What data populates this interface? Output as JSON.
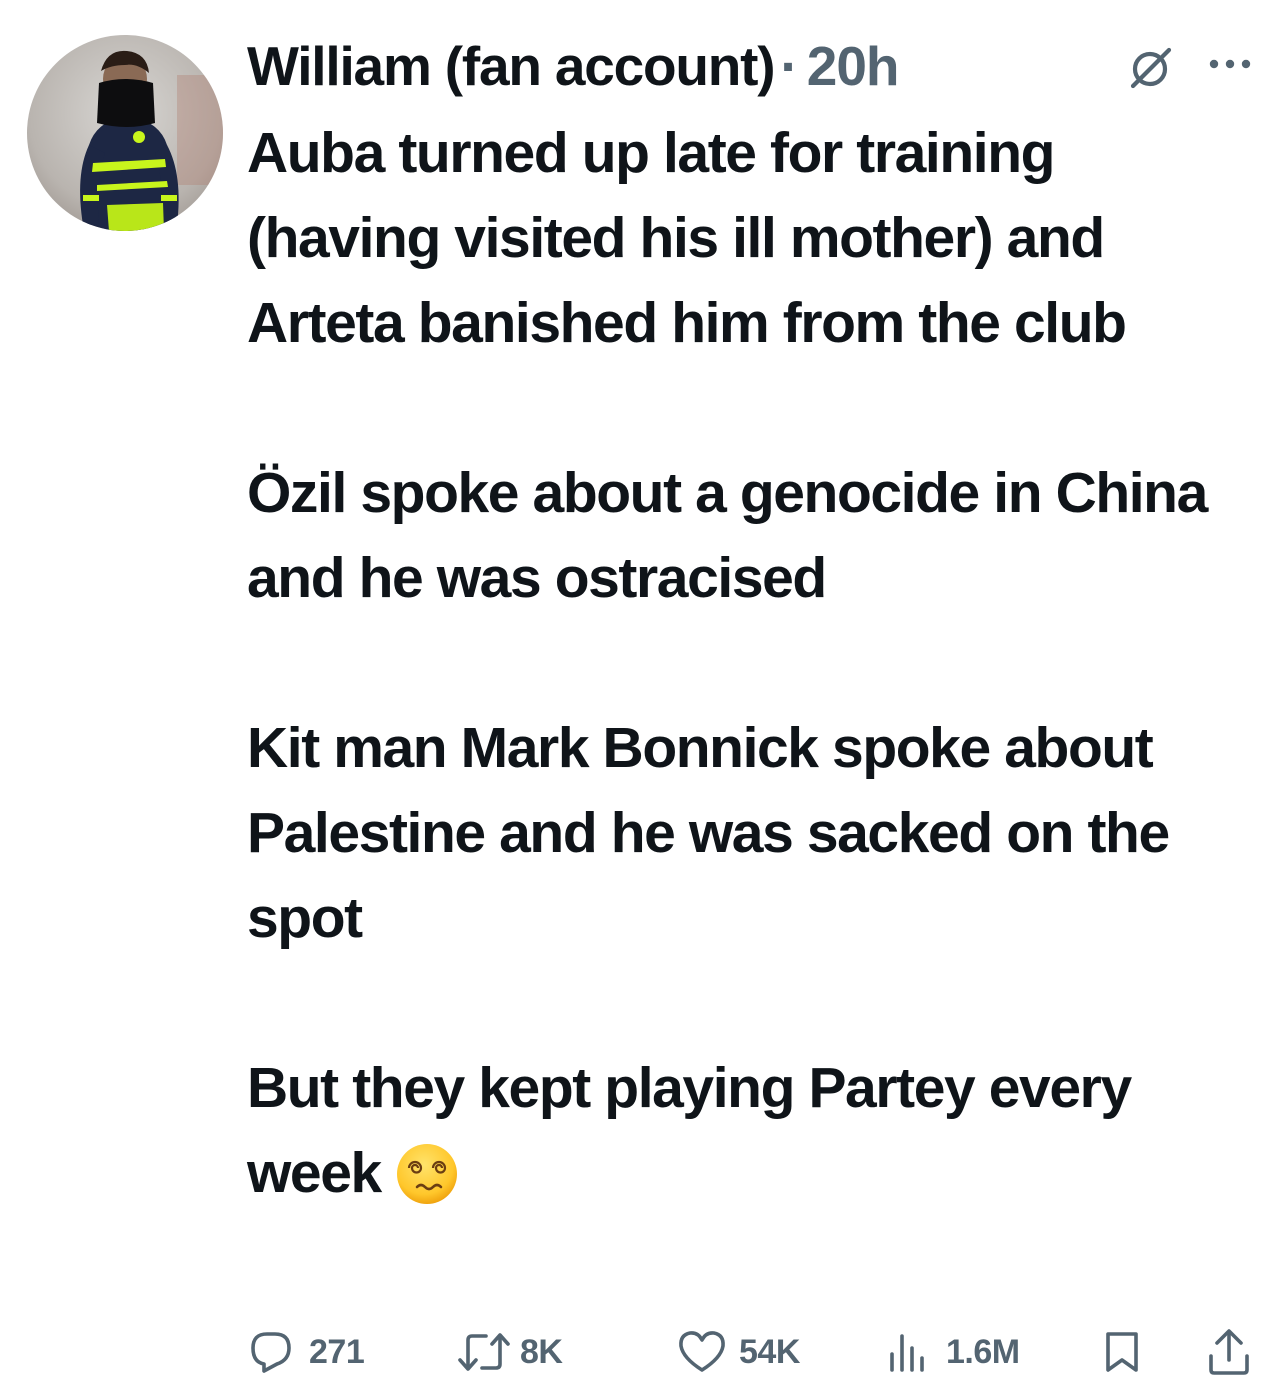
{
  "tweet": {
    "author_name": "William (fan account)",
    "separator": "·",
    "time": "20h",
    "paragraphs": [
      "Auba turned up late for training (having visited his ill mother) and Arteta banished him from the club",
      "Özil spoke about a genocide in China and he was ostracised",
      "Kit man Mark Bonnick spoke about Palestine and he was sacked on the spot",
      "But they kept playing Partey every week"
    ],
    "trailing_emoji": "face-with-spiral-eyes"
  },
  "actions": {
    "replies": "271",
    "reposts": "8K",
    "likes": "54K",
    "views": "1.6M"
  },
  "icons": {
    "header": [
      "grok-icon",
      "more-icon"
    ],
    "actions": [
      "reply-icon",
      "repost-icon",
      "like-icon",
      "views-icon",
      "bookmark-icon",
      "share-icon"
    ]
  },
  "colors": {
    "text": "#0f1419",
    "secondary": "#536471",
    "jacket_accent": "#c8f51c",
    "jacket_navy": "#1d2744"
  }
}
